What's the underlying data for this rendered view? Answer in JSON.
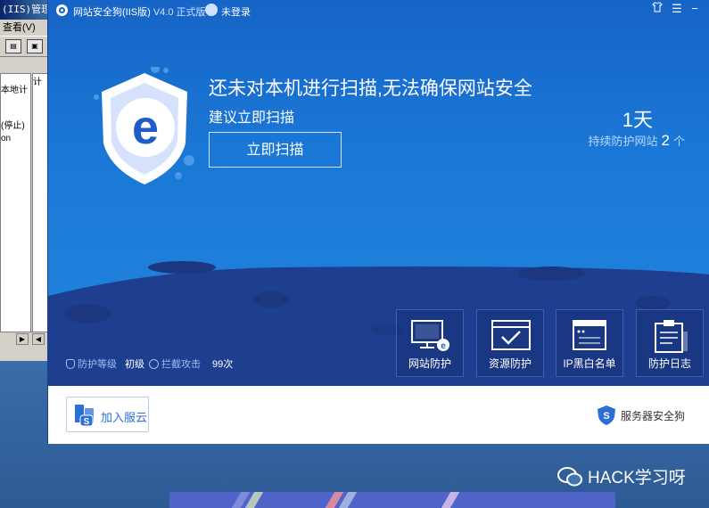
{
  "background_window": {
    "title": "(IIS)管理器",
    "menu_label": "查看(V)",
    "tree_items": [
      "本地计",
      "(停止)",
      "on"
    ],
    "list_header": "计"
  },
  "app": {
    "title": "网站安全狗(IIS版)",
    "version": "V4.0 正式版",
    "login_status": "未登录",
    "controls": [
      "shirt-icon",
      "menu-icon",
      "minimize-icon"
    ],
    "colors": {
      "hero_top": "#1664c6",
      "hero_bottom": "#2187de",
      "moon": "#1d3d8f",
      "accent": "#2b6ed4"
    }
  },
  "scan": {
    "headline": "还未对本机进行扫描,无法确保网站安全",
    "subline": "建议立即扫描",
    "button": "立即扫描"
  },
  "stats": {
    "days": "1天",
    "sites_label": "持续防护网站",
    "sites_count": "2",
    "sites_unit": "个"
  },
  "protection": {
    "level_label": "防护等级",
    "level_value": "初级",
    "intercept_label": "拦截攻击",
    "intercept_count": "99次"
  },
  "features": [
    {
      "label": "网站防护",
      "icon": "monitor-shield-icon"
    },
    {
      "label": "资源防护",
      "icon": "window-check-icon"
    },
    {
      "label": "IP黑白名单",
      "icon": "ip-list-icon"
    },
    {
      "label": "防护日志",
      "icon": "log-clipboard-icon"
    }
  ],
  "footer": {
    "join_button": "加入服云",
    "brand": "服务器安全狗"
  },
  "watermark": "HACK学习呀"
}
